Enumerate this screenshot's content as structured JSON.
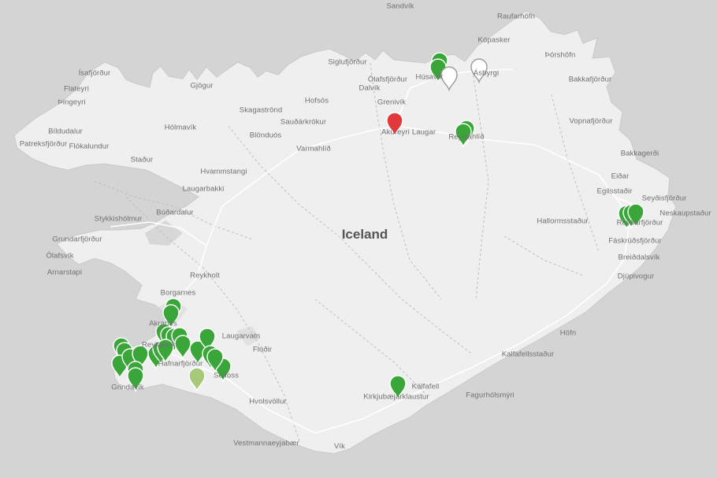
{
  "map": {
    "country_label": "Iceland",
    "colors": {
      "background": "#d4d4d4",
      "land": "#efefef",
      "road": "#ffffff",
      "boundary": "#bdbdbd",
      "marker_green": "#3aa63a",
      "marker_light_green": "#a6c879",
      "marker_red": "#e0393b",
      "marker_white": "#ffffff"
    },
    "places": [
      "Sandvík",
      "Raufarhöfn",
      "Kópasker",
      "Þórshöfn",
      "Bakkafjörður",
      "Siglufjörður",
      "Ólafsfjörður",
      "Dalvík",
      "Grenivík",
      "Húsavík",
      "Ásbyrgi",
      "Ísafjörður",
      "Flateyri",
      "Þingeyri",
      "Gjögur",
      "Hofsós",
      "Skagaströnd",
      "Sauðárkrókur",
      "Blönduós",
      "Varmahlíð",
      "Akureyri",
      "Laugar",
      "Reykjahlíð",
      "Vopnafjörður",
      "Bíldudalur",
      "Patreksfjörður",
      "Flókalundur",
      "Hólmavík",
      "Staður",
      "Bakkagerði",
      "Hvammstangi",
      "Laugarbakki",
      "Eiðar",
      "Egilsstaðir",
      "Seyðisfjörður",
      "Stykkishólmur",
      "Búðardalur",
      "Neskaupstaður",
      "Reyðarfjörður",
      "Hallormsstaður",
      "Fáskrúðsfjörður",
      "Grundarfjörður",
      "Ólafsvík",
      "Arnarstapi",
      "Breiðdalsvík",
      "Reykholt",
      "Djúpivogur",
      "Borgarnes",
      "Akranes",
      "Laugarvatn",
      "Reykjavík",
      "Hafnarfjörður",
      "Selfoss",
      "Flúðir",
      "Höfn",
      "Kalfafellsstaður",
      "Grindavík",
      "Kálfafell",
      "Kirkjubæjarklaustur",
      "Fagurhólsmýri",
      "Hvolsvöllur",
      "Vestmannaeyjabær",
      "Vík"
    ],
    "markers": [
      {
        "status": "green",
        "place": "Húsavík"
      },
      {
        "status": "green",
        "place": "Húsavík"
      },
      {
        "status": "white",
        "place": "Húsavík"
      },
      {
        "status": "white",
        "place": "Ásbyrgi"
      },
      {
        "status": "red",
        "place": "Akureyri"
      },
      {
        "status": "green",
        "place": "Reykjahlíð"
      },
      {
        "status": "green",
        "place": "Reykjahlíð"
      },
      {
        "status": "green",
        "place": "Reyðarfjörður"
      },
      {
        "status": "green",
        "place": "Reyðarfjörður"
      },
      {
        "status": "green",
        "place": "Reyðarfjörður"
      },
      {
        "status": "green",
        "place": "Akranes"
      },
      {
        "status": "green",
        "place": "Akranes"
      },
      {
        "status": "green",
        "place": "Reykjavík"
      },
      {
        "status": "green",
        "place": "Reykjavík"
      },
      {
        "status": "green",
        "place": "Reykjavík"
      },
      {
        "status": "green",
        "place": "Reykjavík"
      },
      {
        "status": "green",
        "place": "Reykjavík"
      },
      {
        "status": "green",
        "place": "Hafnarfjörður"
      },
      {
        "status": "green",
        "place": "Hafnarfjörður"
      },
      {
        "status": "green",
        "place": "Hafnarfjörður"
      },
      {
        "status": "green",
        "place": "Hafnarfjörður"
      },
      {
        "status": "green",
        "place": "Selfoss"
      },
      {
        "status": "green",
        "place": "Selfoss"
      },
      {
        "status": "green",
        "place": "Selfoss"
      },
      {
        "status": "green",
        "place": "Selfoss"
      },
      {
        "status": "light_green",
        "place": "Selfoss"
      },
      {
        "status": "green",
        "place": "Grindavík"
      },
      {
        "status": "green",
        "place": "Grindavík"
      },
      {
        "status": "green",
        "place": "Grindavík"
      },
      {
        "status": "green",
        "place": "Grindavík"
      },
      {
        "status": "green",
        "place": "Grindavík"
      },
      {
        "status": "green",
        "place": "Grindavík"
      },
      {
        "status": "green",
        "place": "Grindavík"
      },
      {
        "status": "green",
        "place": "Kálfafell"
      }
    ]
  }
}
